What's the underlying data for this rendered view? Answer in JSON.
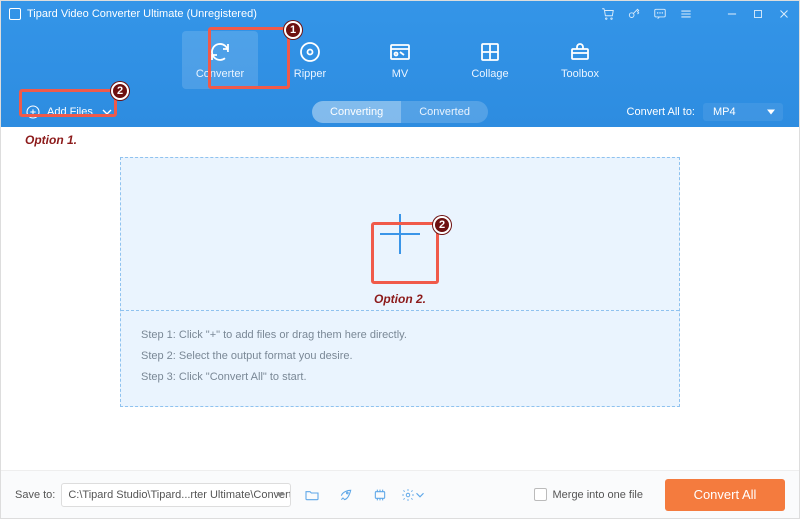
{
  "title": "Tipard Video Converter Ultimate (Unregistered)",
  "tabs": {
    "converter": "Converter",
    "ripper": "Ripper",
    "mv": "MV",
    "collage": "Collage",
    "toolbox": "Toolbox"
  },
  "subbar": {
    "add_files": "Add Files",
    "converting": "Converting",
    "converted": "Converted",
    "convert_all_to": "Convert All to:",
    "format": "MP4"
  },
  "drop": {
    "step1": "Step 1: Click \"+\" to add files or drag them here directly.",
    "step2": "Step 2: Select the output format you desire.",
    "step3": "Step 3: Click \"Convert All\" to start."
  },
  "footer": {
    "save_to": "Save to:",
    "path": "C:\\Tipard Studio\\Tipard...rter Ultimate\\Converted",
    "merge": "Merge into one file",
    "convert_all": "Convert All"
  },
  "annotations": {
    "badge1": "1",
    "badge2": "2",
    "opt1": "Option 1.",
    "opt2": "Option 2."
  }
}
